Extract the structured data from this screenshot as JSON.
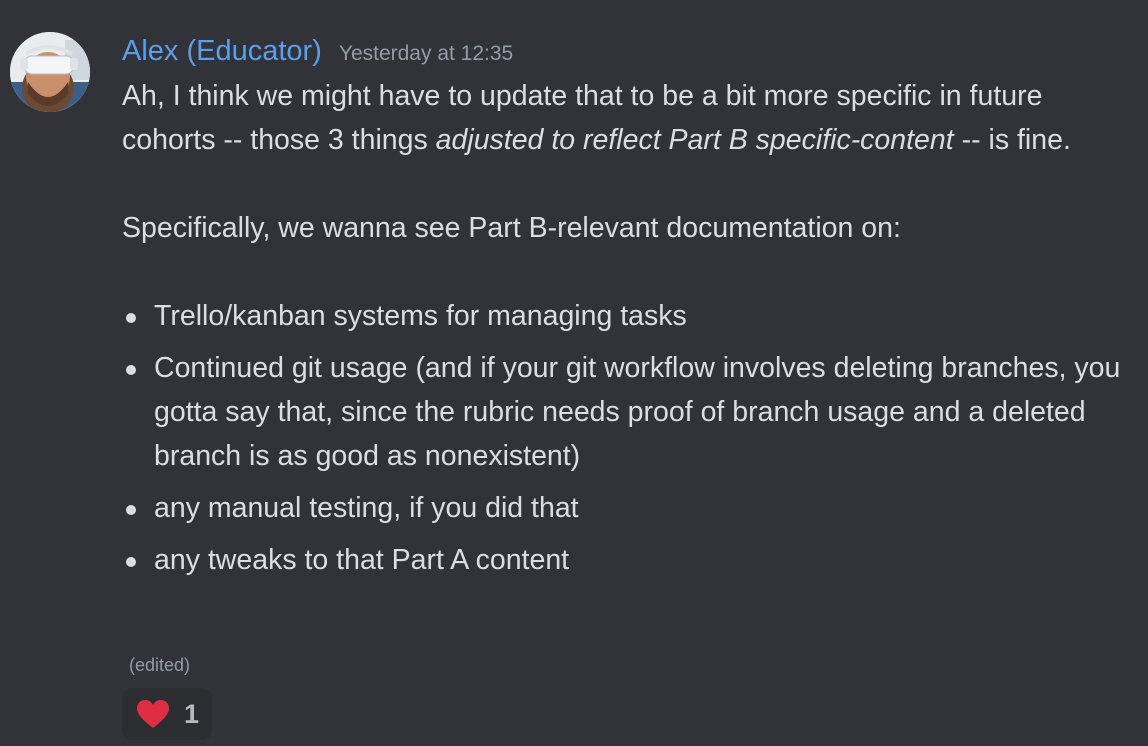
{
  "message": {
    "author": "Alex (Educator)",
    "timestamp": "Yesterday at 12:35",
    "avatar_icon": "user-avatar-photo",
    "intro": {
      "part1": "Ah, I think we might have to update that to be a bit more specific in future cohorts -- those 3 things ",
      "emphasis": "adjusted to reflect Part B specific-content",
      "part2": " -- is fine."
    },
    "lead": "Specifically, we wanna see Part B-relevant documentation on:",
    "bullets": [
      "Trello/kanban systems for managing tasks",
      "Continued git usage (and if your git workflow involves deleting branches, you gotta say that, since the rubric needs proof of branch usage and a deleted branch is as good as nonexistent)",
      "any manual testing, if you did that",
      "any tweaks to that Part A content"
    ],
    "edited_label": "(edited)"
  },
  "reaction": {
    "emoji": "heart-icon",
    "count": "1",
    "color": "#dd2e44"
  },
  "colors": {
    "background": "#313338",
    "author": "#5c9ee8",
    "muted": "#949ba4",
    "text": "#dbdee1"
  }
}
